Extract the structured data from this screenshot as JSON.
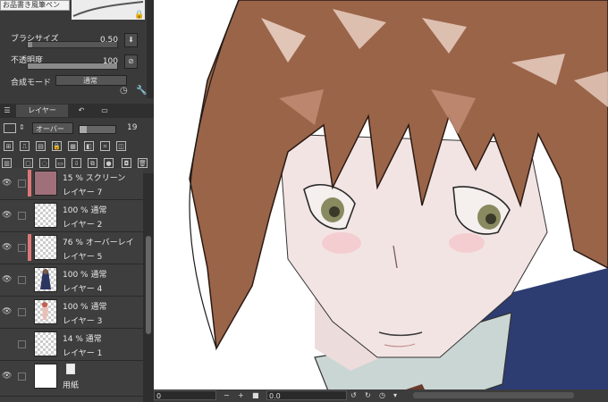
{
  "tool_property": {
    "brush_name": "お品書き風筆ペン",
    "brush_size_label": "ブラシサイズ",
    "brush_size_value": "0.50",
    "brush_size_fraction": 0.05,
    "opacity_label": "不透明度",
    "opacity_value": "100",
    "opacity_fraction": 1.0,
    "blend_mode_label": "合成モード",
    "blend_mode_value": "通常"
  },
  "layer_panel": {
    "tab_layer": "レイヤー",
    "blend_select": "オーバー",
    "opacity_value": "19",
    "opacity_fraction": 0.19
  },
  "layers": [
    {
      "line1": "15 % スクリーン",
      "line2": "レイヤー 7",
      "visible": true,
      "color_tag": "#d77",
      "thumb": "solid"
    },
    {
      "line1": "100 % 通常",
      "line2": "レイヤー 2",
      "visible": true,
      "color_tag": null,
      "thumb": "transparent"
    },
    {
      "line1": "76 % オーバーレイ",
      "line2": "レイヤー 5",
      "visible": true,
      "color_tag": "#d77",
      "thumb": "transparent"
    },
    {
      "line1": "100 % 通常",
      "line2": "レイヤー 4",
      "visible": true,
      "color_tag": null,
      "thumb": "figure"
    },
    {
      "line1": "100 % 通常",
      "line2": "レイヤー 3",
      "visible": true,
      "color_tag": null,
      "thumb": "figure-red"
    },
    {
      "line1": "14 % 通常",
      "line2": "レイヤー 1",
      "visible": false,
      "color_tag": null,
      "thumb": "transparent"
    },
    {
      "line1": "",
      "line2": "用紙",
      "visible": true,
      "color_tag": null,
      "thumb": "paper"
    }
  ],
  "canvas_bar": {
    "left_value": "0",
    "zoom_value": "0.0"
  },
  "colors": {
    "panel_bg": "#3a3a3a",
    "hair": "#9a6448",
    "hair_highlight": "#e9cfc3",
    "skin": "#f3e4e4",
    "jacket": "#2d3d72",
    "shirt": "#c9d6d4"
  }
}
